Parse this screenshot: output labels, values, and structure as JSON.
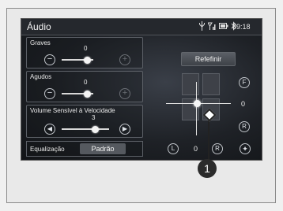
{
  "header": {
    "title": "Áudio",
    "time": "09:18"
  },
  "status_icons": [
    "usb-icon",
    "signal-icon",
    "battery-icon",
    "bluetooth-icon"
  ],
  "panels": {
    "bass": {
      "label": "Graves",
      "value": "0",
      "level": 0.5
    },
    "treble": {
      "label": "Agudos",
      "value": "0",
      "level": 0.5
    },
    "svc": {
      "label": "Volume Sensível à Velocidade",
      "value": "3",
      "level": 0.75
    }
  },
  "equalizer": {
    "label": "Equalização",
    "preset": "Padrão"
  },
  "reset_label": "Refefinir",
  "balance": {
    "fader_value": "0",
    "balance_value": "0",
    "front_label": "F",
    "rear_label": "R",
    "left_label": "L",
    "right_label": "R"
  },
  "callout_number": "1"
}
